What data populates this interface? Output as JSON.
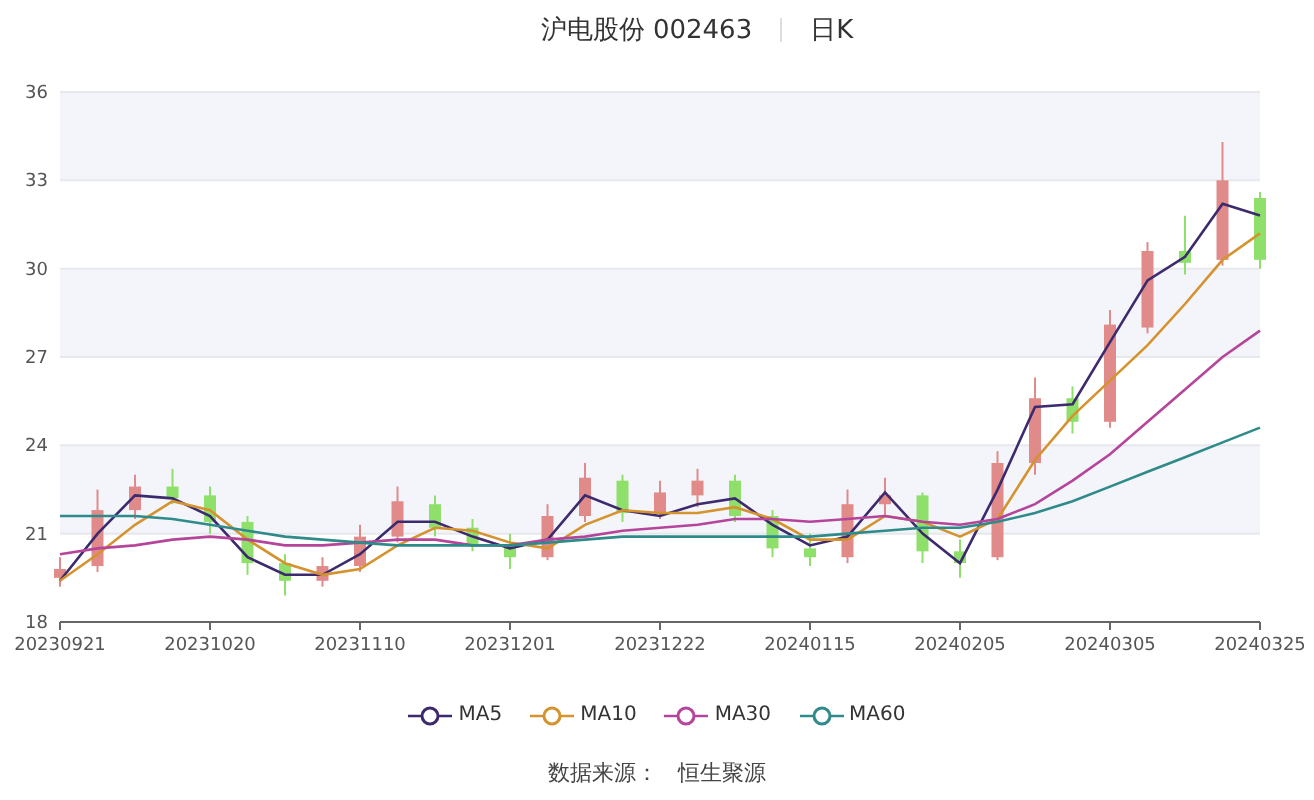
{
  "header": {
    "stock": "沪电股份 002463",
    "period": "日K"
  },
  "chart": {
    "chart_data": {
      "type": "candlestick",
      "categories": [
        "20230921",
        null,
        null,
        null,
        "20231020",
        null,
        null,
        null,
        "20231110",
        null,
        null,
        null,
        "20231201",
        null,
        null,
        null,
        "20231222",
        null,
        null,
        null,
        "20240115",
        null,
        null,
        null,
        "20240205",
        null,
        null,
        null,
        "20240305",
        null,
        null,
        null,
        "20240325"
      ],
      "ylim": [
        18,
        36
      ],
      "yticks": [
        18,
        21,
        24,
        27,
        30,
        33,
        36
      ],
      "grid": true,
      "ohlc": [
        [
          19.5,
          20.2,
          19.2,
          19.8
        ],
        [
          19.9,
          22.5,
          19.7,
          21.8
        ],
        [
          21.8,
          23.0,
          21.5,
          22.6
        ],
        [
          22.6,
          23.2,
          22.0,
          22.2
        ],
        [
          22.3,
          22.6,
          21.0,
          21.4
        ],
        [
          21.4,
          21.6,
          19.6,
          20.0
        ],
        [
          20.0,
          20.3,
          18.9,
          19.4
        ],
        [
          19.4,
          20.2,
          19.2,
          19.9
        ],
        [
          19.9,
          21.3,
          19.7,
          20.9
        ],
        [
          20.9,
          22.6,
          20.7,
          22.1
        ],
        [
          22.0,
          22.3,
          20.9,
          21.2
        ],
        [
          21.2,
          21.5,
          20.4,
          20.6
        ],
        [
          20.6,
          21.0,
          19.8,
          20.2
        ],
        [
          20.2,
          22.0,
          20.1,
          21.6
        ],
        [
          21.6,
          23.4,
          21.4,
          22.9
        ],
        [
          22.8,
          23.0,
          21.4,
          21.7
        ],
        [
          21.7,
          22.8,
          21.5,
          22.4
        ],
        [
          22.3,
          23.2,
          21.9,
          22.8
        ],
        [
          22.8,
          23.0,
          21.4,
          21.6
        ],
        [
          21.6,
          21.8,
          20.2,
          20.5
        ],
        [
          20.5,
          21.0,
          19.9,
          20.2
        ],
        [
          20.2,
          22.5,
          20.0,
          22.0
        ],
        [
          22.0,
          22.9,
          21.6,
          22.3
        ],
        [
          22.3,
          22.4,
          20.0,
          20.4
        ],
        [
          20.4,
          20.8,
          19.5,
          20.0
        ],
        [
          20.2,
          23.8,
          20.1,
          23.4
        ],
        [
          23.4,
          26.3,
          23.0,
          25.6
        ],
        [
          25.6,
          26.0,
          24.4,
          24.8
        ],
        [
          24.8,
          28.6,
          24.6,
          28.1
        ],
        [
          28.0,
          30.9,
          27.8,
          30.6
        ],
        [
          30.6,
          31.8,
          29.8,
          30.2
        ],
        [
          30.3,
          34.3,
          30.1,
          33.0
        ],
        [
          32.4,
          32.6,
          30.0,
          30.3
        ]
      ],
      "series": [
        {
          "name": "MA5",
          "type": "line",
          "color": "#3d2a6e",
          "values": [
            19.4,
            21.0,
            22.3,
            22.2,
            21.6,
            20.2,
            19.6,
            19.6,
            20.3,
            21.4,
            21.4,
            20.9,
            20.5,
            20.8,
            22.3,
            21.8,
            21.6,
            22.0,
            22.2,
            21.3,
            20.6,
            20.9,
            22.4,
            21.0,
            20.0,
            22.5,
            25.3,
            25.4,
            27.5,
            29.6,
            30.4,
            32.2,
            31.8
          ]
        },
        {
          "name": "MA10",
          "type": "line",
          "color": "#d4932f",
          "values": [
            19.4,
            20.3,
            21.3,
            22.1,
            21.8,
            20.8,
            20.0,
            19.6,
            19.8,
            20.6,
            21.2,
            21.1,
            20.7,
            20.5,
            21.3,
            21.8,
            21.7,
            21.7,
            21.9,
            21.5,
            20.8,
            20.8,
            21.6,
            21.4,
            20.9,
            21.5,
            23.5,
            25.0,
            26.2,
            27.4,
            28.8,
            30.3,
            31.2
          ]
        },
        {
          "name": "MA30",
          "type": "line",
          "color": "#b5459b",
          "values": [
            20.3,
            20.5,
            20.6,
            20.8,
            20.9,
            20.8,
            20.6,
            20.6,
            20.7,
            20.8,
            20.8,
            20.6,
            20.6,
            20.8,
            20.9,
            21.1,
            21.2,
            21.3,
            21.5,
            21.5,
            21.4,
            21.5,
            21.6,
            21.4,
            21.3,
            21.5,
            22.0,
            22.8,
            23.7,
            24.8,
            25.9,
            27.0,
            27.9
          ]
        },
        {
          "name": "MA60",
          "type": "line",
          "color": "#2f8a8a",
          "values": [
            21.6,
            21.6,
            21.6,
            21.5,
            21.3,
            21.1,
            20.9,
            20.8,
            20.7,
            20.6,
            20.6,
            20.6,
            20.6,
            20.7,
            20.8,
            20.9,
            20.9,
            20.9,
            20.9,
            20.9,
            20.9,
            21.0,
            21.1,
            21.2,
            21.2,
            21.4,
            21.7,
            22.1,
            22.6,
            23.1,
            23.6,
            24.1,
            24.6
          ]
        }
      ]
    }
  },
  "source": {
    "label": "数据来源：",
    "value": "恒生聚源"
  }
}
